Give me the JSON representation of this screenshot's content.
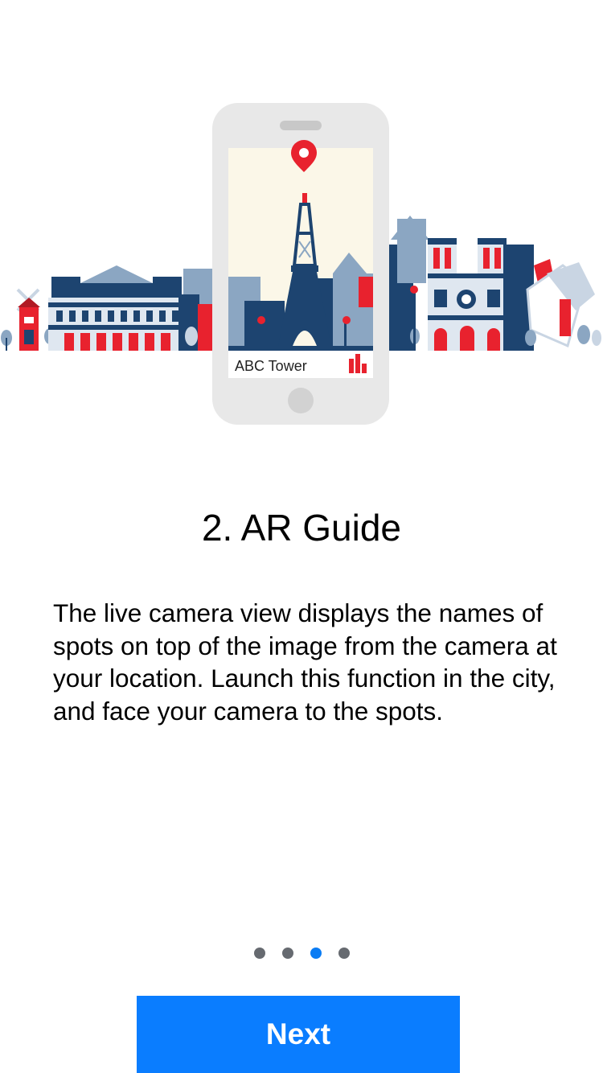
{
  "onboarding": {
    "step_title": "2. AR Guide",
    "description": "The live camera view displays the names of spots on top of the image from the camera at your location. Launch this function in the city, and face your camera to the spots.",
    "illustration": {
      "phone_label": "ABC Tower",
      "icons": [
        "map-pin-icon",
        "bar-chart-icon",
        "eiffel-tower-illustration",
        "city-skyline-illustration"
      ]
    },
    "pager": {
      "total_pages": 4,
      "current_page": 3
    },
    "next_label": "Next"
  },
  "colors": {
    "accent": "#0a7dff",
    "active_dot": "#0a7cf4",
    "inactive_dot": "#666a70",
    "brand_red": "#e8222e",
    "skyline_navy": "#1d4470",
    "skyline_steel": "#8ba6c2"
  }
}
